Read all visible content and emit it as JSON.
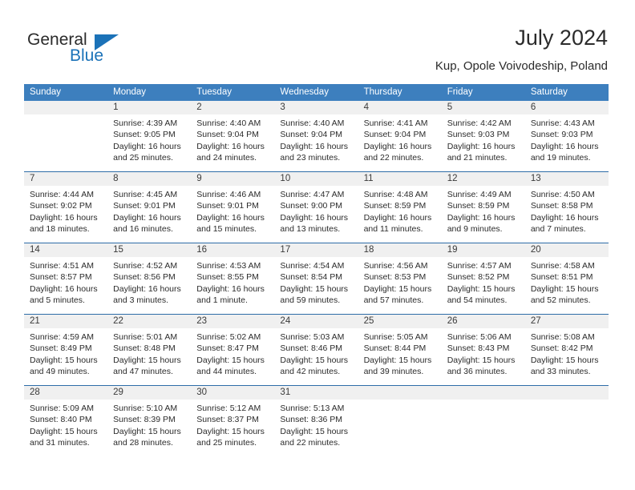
{
  "brand": {
    "name_part1": "General",
    "name_part2": "Blue",
    "accent_color": "#1b72b8",
    "triangle_icon": "triangle-icon"
  },
  "header": {
    "title": "July 2024",
    "location": "Kup, Opole Voivodeship, Poland"
  },
  "calendar": {
    "header_bg": "#3d7fbe",
    "row_divider_color": "#2e6da8",
    "daynum_bg": "#f0f0f0",
    "weekdays": [
      "Sunday",
      "Monday",
      "Tuesday",
      "Wednesday",
      "Thursday",
      "Friday",
      "Saturday"
    ],
    "weeks": [
      [
        {
          "day": "",
          "lines": []
        },
        {
          "day": "1",
          "lines": [
            "Sunrise: 4:39 AM",
            "Sunset: 9:05 PM",
            "Daylight: 16 hours",
            "and 25 minutes."
          ]
        },
        {
          "day": "2",
          "lines": [
            "Sunrise: 4:40 AM",
            "Sunset: 9:04 PM",
            "Daylight: 16 hours",
            "and 24 minutes."
          ]
        },
        {
          "day": "3",
          "lines": [
            "Sunrise: 4:40 AM",
            "Sunset: 9:04 PM",
            "Daylight: 16 hours",
            "and 23 minutes."
          ]
        },
        {
          "day": "4",
          "lines": [
            "Sunrise: 4:41 AM",
            "Sunset: 9:04 PM",
            "Daylight: 16 hours",
            "and 22 minutes."
          ]
        },
        {
          "day": "5",
          "lines": [
            "Sunrise: 4:42 AM",
            "Sunset: 9:03 PM",
            "Daylight: 16 hours",
            "and 21 minutes."
          ]
        },
        {
          "day": "6",
          "lines": [
            "Sunrise: 4:43 AM",
            "Sunset: 9:03 PM",
            "Daylight: 16 hours",
            "and 19 minutes."
          ]
        }
      ],
      [
        {
          "day": "7",
          "lines": [
            "Sunrise: 4:44 AM",
            "Sunset: 9:02 PM",
            "Daylight: 16 hours",
            "and 18 minutes."
          ]
        },
        {
          "day": "8",
          "lines": [
            "Sunrise: 4:45 AM",
            "Sunset: 9:01 PM",
            "Daylight: 16 hours",
            "and 16 minutes."
          ]
        },
        {
          "day": "9",
          "lines": [
            "Sunrise: 4:46 AM",
            "Sunset: 9:01 PM",
            "Daylight: 16 hours",
            "and 15 minutes."
          ]
        },
        {
          "day": "10",
          "lines": [
            "Sunrise: 4:47 AM",
            "Sunset: 9:00 PM",
            "Daylight: 16 hours",
            "and 13 minutes."
          ]
        },
        {
          "day": "11",
          "lines": [
            "Sunrise: 4:48 AM",
            "Sunset: 8:59 PM",
            "Daylight: 16 hours",
            "and 11 minutes."
          ]
        },
        {
          "day": "12",
          "lines": [
            "Sunrise: 4:49 AM",
            "Sunset: 8:59 PM",
            "Daylight: 16 hours",
            "and 9 minutes."
          ]
        },
        {
          "day": "13",
          "lines": [
            "Sunrise: 4:50 AM",
            "Sunset: 8:58 PM",
            "Daylight: 16 hours",
            "and 7 minutes."
          ]
        }
      ],
      [
        {
          "day": "14",
          "lines": [
            "Sunrise: 4:51 AM",
            "Sunset: 8:57 PM",
            "Daylight: 16 hours",
            "and 5 minutes."
          ]
        },
        {
          "day": "15",
          "lines": [
            "Sunrise: 4:52 AM",
            "Sunset: 8:56 PM",
            "Daylight: 16 hours",
            "and 3 minutes."
          ]
        },
        {
          "day": "16",
          "lines": [
            "Sunrise: 4:53 AM",
            "Sunset: 8:55 PM",
            "Daylight: 16 hours",
            "and 1 minute."
          ]
        },
        {
          "day": "17",
          "lines": [
            "Sunrise: 4:54 AM",
            "Sunset: 8:54 PM",
            "Daylight: 15 hours",
            "and 59 minutes."
          ]
        },
        {
          "day": "18",
          "lines": [
            "Sunrise: 4:56 AM",
            "Sunset: 8:53 PM",
            "Daylight: 15 hours",
            "and 57 minutes."
          ]
        },
        {
          "day": "19",
          "lines": [
            "Sunrise: 4:57 AM",
            "Sunset: 8:52 PM",
            "Daylight: 15 hours",
            "and 54 minutes."
          ]
        },
        {
          "day": "20",
          "lines": [
            "Sunrise: 4:58 AM",
            "Sunset: 8:51 PM",
            "Daylight: 15 hours",
            "and 52 minutes."
          ]
        }
      ],
      [
        {
          "day": "21",
          "lines": [
            "Sunrise: 4:59 AM",
            "Sunset: 8:49 PM",
            "Daylight: 15 hours",
            "and 49 minutes."
          ]
        },
        {
          "day": "22",
          "lines": [
            "Sunrise: 5:01 AM",
            "Sunset: 8:48 PM",
            "Daylight: 15 hours",
            "and 47 minutes."
          ]
        },
        {
          "day": "23",
          "lines": [
            "Sunrise: 5:02 AM",
            "Sunset: 8:47 PM",
            "Daylight: 15 hours",
            "and 44 minutes."
          ]
        },
        {
          "day": "24",
          "lines": [
            "Sunrise: 5:03 AM",
            "Sunset: 8:46 PM",
            "Daylight: 15 hours",
            "and 42 minutes."
          ]
        },
        {
          "day": "25",
          "lines": [
            "Sunrise: 5:05 AM",
            "Sunset: 8:44 PM",
            "Daylight: 15 hours",
            "and 39 minutes."
          ]
        },
        {
          "day": "26",
          "lines": [
            "Sunrise: 5:06 AM",
            "Sunset: 8:43 PM",
            "Daylight: 15 hours",
            "and 36 minutes."
          ]
        },
        {
          "day": "27",
          "lines": [
            "Sunrise: 5:08 AM",
            "Sunset: 8:42 PM",
            "Daylight: 15 hours",
            "and 33 minutes."
          ]
        }
      ],
      [
        {
          "day": "28",
          "lines": [
            "Sunrise: 5:09 AM",
            "Sunset: 8:40 PM",
            "Daylight: 15 hours",
            "and 31 minutes."
          ]
        },
        {
          "day": "29",
          "lines": [
            "Sunrise: 5:10 AM",
            "Sunset: 8:39 PM",
            "Daylight: 15 hours",
            "and 28 minutes."
          ]
        },
        {
          "day": "30",
          "lines": [
            "Sunrise: 5:12 AM",
            "Sunset: 8:37 PM",
            "Daylight: 15 hours",
            "and 25 minutes."
          ]
        },
        {
          "day": "31",
          "lines": [
            "Sunrise: 5:13 AM",
            "Sunset: 8:36 PM",
            "Daylight: 15 hours",
            "and 22 minutes."
          ]
        },
        {
          "day": "",
          "lines": []
        },
        {
          "day": "",
          "lines": []
        },
        {
          "day": "",
          "lines": []
        }
      ]
    ]
  }
}
